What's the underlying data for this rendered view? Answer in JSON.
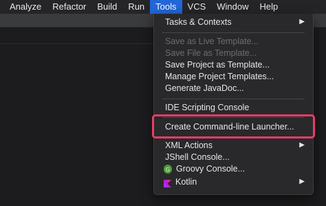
{
  "menubar": {
    "items": [
      "Analyze",
      "Refactor",
      "Build",
      "Run",
      "Tools",
      "VCS",
      "Window",
      "Help"
    ],
    "active": "Tools"
  },
  "tools_menu": {
    "tasks_contexts": "Tasks & Contexts",
    "save_live_template": "Save as Live Template...",
    "save_file_template": "Save File as Template...",
    "save_project_template": "Save Project as Template...",
    "manage_project_templates": "Manage Project Templates...",
    "generate_javadoc": "Generate JavaDoc...",
    "ide_scripting_console": "IDE Scripting Console",
    "create_launcher": "Create Command-line Launcher...",
    "xml_actions": "XML Actions",
    "jshell_console": "JShell Console...",
    "groovy_console": "Groovy Console...",
    "kotlin": "Kotlin",
    "submenu_arrow": "▶",
    "groovy_icon_letter": "G"
  },
  "colors": {
    "menu_active": "#2366d8",
    "highlight_border": "#ea3d68",
    "groovy_icon": "#4a9d3a",
    "kotlin_icon": [
      "#7f52ff",
      "#e44857",
      "#c711e1"
    ]
  },
  "icons": {
    "submenu": "chevron-right-icon",
    "groovy": "groovy-icon",
    "kotlin": "kotlin-icon"
  }
}
